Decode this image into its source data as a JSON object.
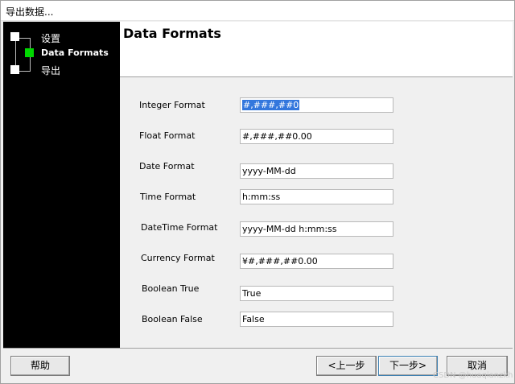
{
  "window": {
    "title": "导出数据..."
  },
  "steps": [
    {
      "label": "设置",
      "active": false
    },
    {
      "label": "Data Formats",
      "active": true
    },
    {
      "label": "导出",
      "active": false
    }
  ],
  "page": {
    "title": "Data Formats"
  },
  "fields": [
    {
      "label": "Integer Format",
      "value": "#,###,##0",
      "selected": true
    },
    {
      "label": "Float Format",
      "value": "#,###,##0.00"
    },
    {
      "label": "Date Format",
      "value": "yyyy-MM-dd"
    },
    {
      "label": "Time Format",
      "value": "h:mm:ss"
    },
    {
      "label": "DateTime Format",
      "value": "yyyy-MM-dd h:mm:ss"
    },
    {
      "label": "Currency Format",
      "value": "¥#,###,##0.00"
    },
    {
      "label": "Boolean True",
      "value": "True"
    },
    {
      "label": "Boolean False",
      "value": "False"
    }
  ],
  "buttons": {
    "help": "帮助",
    "back": "<上一步",
    "next": "下一步>",
    "cancel": "取消"
  },
  "watermark": "CSDN @huaqianzkh",
  "colors": {
    "active_step": "#00d800",
    "selection": "#3377dd"
  }
}
